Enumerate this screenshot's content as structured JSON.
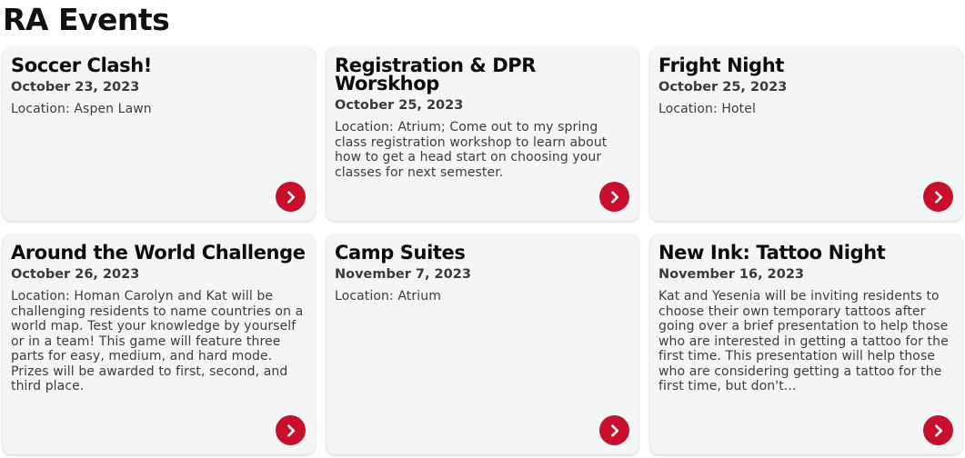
{
  "page": {
    "title": "RA Events"
  },
  "colors": {
    "accent": "#c8102e",
    "card_bg": "#f4f5f6"
  },
  "icons": {
    "card_action": "chevron-right-icon"
  },
  "events": [
    {
      "title": "Soccer Clash!",
      "date": "October 23, 2023",
      "description": "Location: Aspen Lawn"
    },
    {
      "title": "Registration & DPR Worskhop",
      "date": "October 25, 2023",
      "description": "Location: Atrium; Come out to my spring class registration workshop to learn about how to get a head start on choosing your classes for next semester."
    },
    {
      "title": "Fright Night",
      "date": "October 25, 2023",
      "description": "Location: Hotel"
    },
    {
      "title": "Around the World Challenge",
      "date": "October 26, 2023",
      "description": "Location: Homan Carolyn and Kat will be challenging residents to name countries on a world map. Test your knowledge by yourself or in a team! This game will feature three parts for easy, medium, and hard mode. Prizes will be awarded to first, second, and third place."
    },
    {
      "title": "Camp Suites",
      "date": "November 7, 2023",
      "description": "Location: Atrium"
    },
    {
      "title": "New Ink: Tattoo Night",
      "date": "November 16, 2023",
      "description": "Kat and Yesenia will be inviting residents to choose their own temporary tattoos after going over a brief presentation to help those who are interested in getting a tattoo for the first time. This presentation will help those who are considering getting a tattoo for the first time, but don't..."
    }
  ]
}
